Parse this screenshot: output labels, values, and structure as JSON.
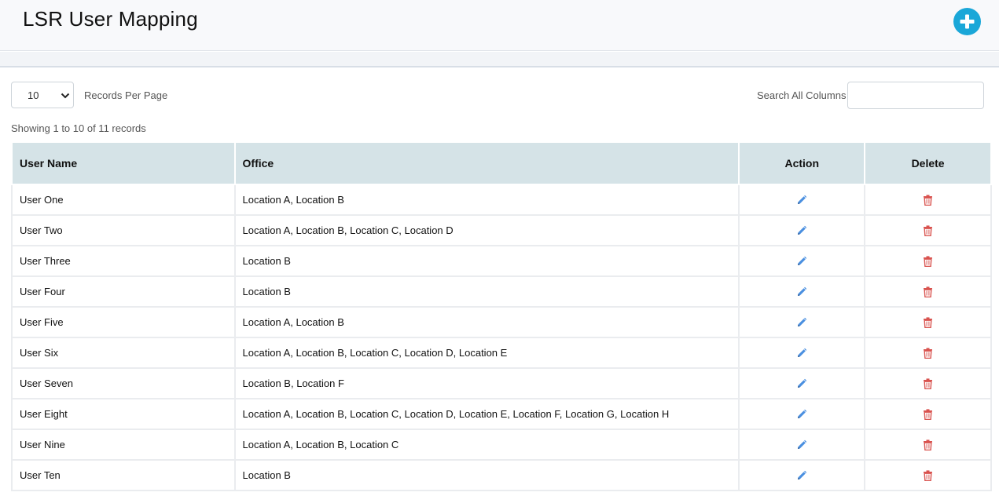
{
  "header": {
    "title": "LSR User Mapping",
    "add_icon": "plus-circle-icon",
    "accent_color": "#1aa7d8"
  },
  "controls": {
    "page_size": "10",
    "records_per_page_label": "Records Per Page",
    "search_label": "Search All Columns",
    "search_value": ""
  },
  "summary": "Showing 1 to 10 of 11 records",
  "table": {
    "headers": [
      "User Name",
      "Office",
      "Action",
      "Delete"
    ],
    "action_icon": "pencil-icon",
    "delete_icon": "trash-icon",
    "rows": [
      {
        "user": "User One",
        "office": "Location A, Location B"
      },
      {
        "user": "User Two",
        "office": "Location A, Location B, Location C, Location D"
      },
      {
        "user": "User Three",
        "office": "Location B"
      },
      {
        "user": "User Four",
        "office": "Location B"
      },
      {
        "user": "User Five",
        "office": "Location A, Location B"
      },
      {
        "user": "User Six",
        "office": "Location A, Location B, Location C, Location D, Location E"
      },
      {
        "user": "User Seven",
        "office": "Location B, Location F"
      },
      {
        "user": "User Eight",
        "office": "Location A, Location B, Location C, Location D, Location E, Location F, Location G, Location H"
      },
      {
        "user": "User Nine",
        "office": "Location A, Location B, Location C"
      },
      {
        "user": "User Ten",
        "office": "Location B"
      }
    ]
  }
}
